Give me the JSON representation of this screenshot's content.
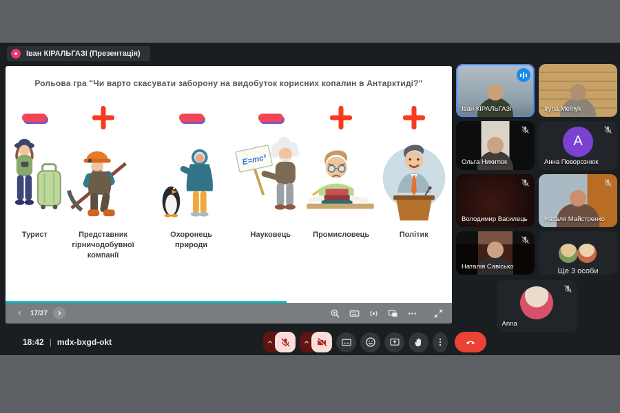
{
  "header": {
    "presenter_chip": "Іван КІРАЛЬГАЗІ (Презентація)"
  },
  "slide": {
    "title": "Рольова гра \"Чи варто скасувати заборону на видобуток корисних копалин в Антарктиді?\"",
    "characters": [
      {
        "label": "Турист",
        "sign": "minus"
      },
      {
        "label": "Представник гірничодобувної компанії",
        "sign": "plus"
      },
      {
        "label": "Охоронець природи",
        "sign": "minus"
      },
      {
        "label": "Науковець",
        "sign": "minus",
        "placard_text": "E=mc²"
      },
      {
        "label": "Промисловець",
        "sign": "plus"
      },
      {
        "label": "Політик",
        "sign": "plus"
      }
    ],
    "controls": {
      "page_indicator": "17/27",
      "progress_percent": 63
    }
  },
  "participants": [
    {
      "name": "Іван КІРАЛЬГАЗІ",
      "speaking": true,
      "muted": false
    },
    {
      "name": "Iryna Melnyk",
      "muted": false
    },
    {
      "name": "Ольга Никитюк",
      "muted": true
    },
    {
      "name": "Анна Поворознюк",
      "muted": true,
      "avatar_letter": "A"
    },
    {
      "name": "Володимир Василець",
      "muted": true
    },
    {
      "name": "Наталя Майстренко",
      "muted": true
    },
    {
      "name": "Наталія Савісько",
      "muted": true
    },
    {
      "name": "Ще 3 особи"
    },
    {
      "name": "Anna",
      "muted": true
    }
  ],
  "bottom_bar": {
    "time": "18:42",
    "meeting_code": "mdx-bxgd-okt"
  },
  "colors": {
    "accent_teal": "#00c0cc",
    "speaking_border": "#4c8bf5",
    "end_call_red": "#ea4335",
    "sign_plus_red": "#f63b1e",
    "sign_minus_red": "#f24656",
    "avatar_purple": "#7b42d1",
    "chip_pink": "#e83a6b"
  }
}
